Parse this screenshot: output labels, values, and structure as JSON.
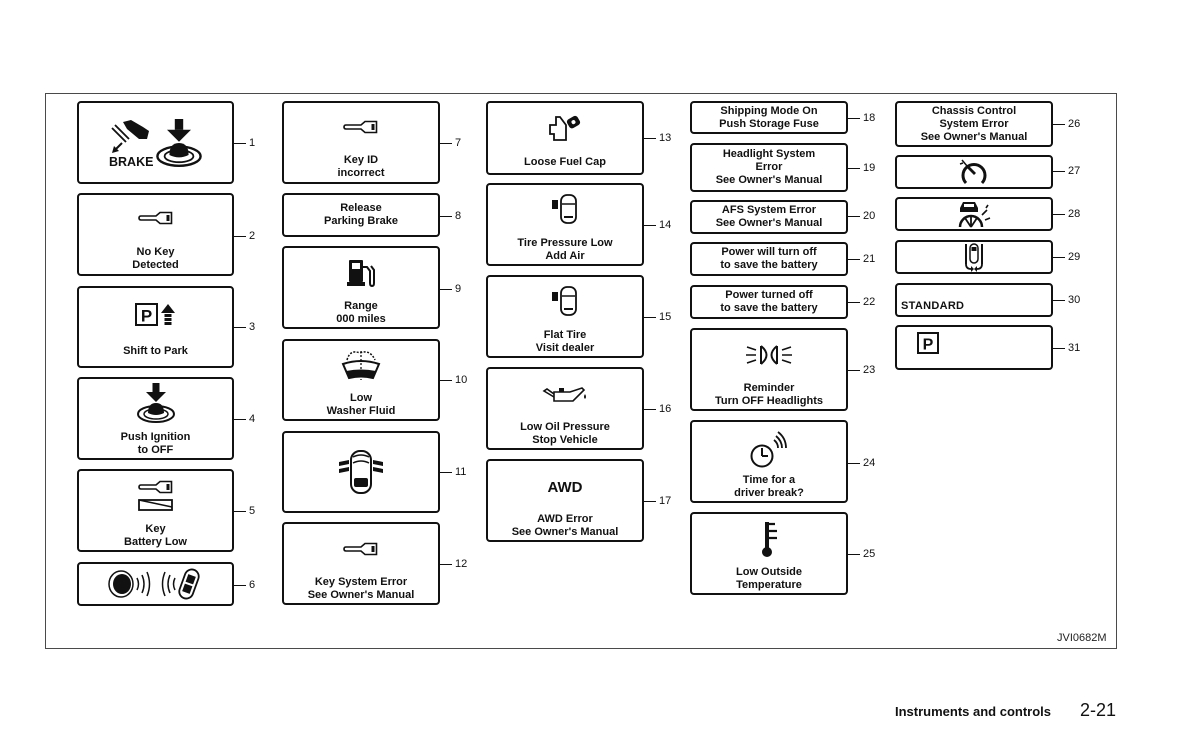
{
  "figure": {
    "code": "JVI0682M",
    "items": [
      {
        "number": "1",
        "icon": "brake-push-ignition-icon",
        "icon_text": "BRAKE",
        "lines": []
      },
      {
        "number": "2",
        "icon": "key-icon",
        "lines": [
          "No Key",
          "Detected"
        ]
      },
      {
        "number": "3",
        "icon": "shift-to-park-icon",
        "icon_text": "P",
        "lines": [
          "Shift to Park"
        ]
      },
      {
        "number": "4",
        "icon": "push-ignition-icon",
        "lines": [
          "Push Ignition",
          "to OFF"
        ]
      },
      {
        "number": "5",
        "icon": "key-battery-icon",
        "lines": [
          "Key",
          "Battery Low"
        ]
      },
      {
        "number": "6",
        "icon": "key-fob-signal-icon",
        "lines": []
      },
      {
        "number": "7",
        "icon": "key-icon",
        "lines": [
          "Key ID",
          "incorrect"
        ]
      },
      {
        "number": "8",
        "lines": [
          "Release",
          "Parking Brake"
        ]
      },
      {
        "number": "9",
        "icon": "fuel-pump-icon",
        "lines": [
          "Range",
          "000 miles"
        ]
      },
      {
        "number": "10",
        "icon": "washer-fluid-icon",
        "lines": [
          "Low",
          "Washer Fluid"
        ]
      },
      {
        "number": "11",
        "icon": "door-open-icon",
        "lines": []
      },
      {
        "number": "12",
        "icon": "key-icon",
        "lines": [
          "Key System Error",
          "See Owner's Manual"
        ]
      },
      {
        "number": "13",
        "icon": "fuel-cap-icon",
        "lines": [
          "Loose Fuel Cap"
        ]
      },
      {
        "number": "14",
        "icon": "tire-pressure-icon",
        "lines": [
          "Tire Pressure Low",
          "Add Air"
        ]
      },
      {
        "number": "15",
        "icon": "flat-tire-icon",
        "lines": [
          "Flat Tire",
          "Visit dealer"
        ]
      },
      {
        "number": "16",
        "icon": "oil-can-icon",
        "lines": [
          "Low Oil Pressure",
          "Stop Vehicle"
        ]
      },
      {
        "number": "17",
        "icon_text": "AWD",
        "lines": [
          "AWD Error",
          "See Owner's Manual"
        ]
      },
      {
        "number": "18",
        "lines": [
          "Shipping Mode On",
          "Push Storage Fuse"
        ]
      },
      {
        "number": "19",
        "lines": [
          "Headlight System",
          "Error",
          "See Owner's Manual"
        ]
      },
      {
        "number": "20",
        "lines": [
          "AFS System Error",
          "See Owner's Manual"
        ]
      },
      {
        "number": "21",
        "lines": [
          "Power will turn off",
          "to save the battery"
        ]
      },
      {
        "number": "22",
        "lines": [
          "Power turned off",
          "to save the battery"
        ]
      },
      {
        "number": "23",
        "icon": "headlight-icon",
        "lines": [
          "Reminder",
          "Turn OFF Headlights"
        ]
      },
      {
        "number": "24",
        "icon": "clock-break-icon",
        "lines": [
          "Time for a",
          "driver break?"
        ]
      },
      {
        "number": "25",
        "icon": "thermometer-icon",
        "lines": [
          "Low Outside",
          "Temperature"
        ]
      },
      {
        "number": "26",
        "lines": [
          "Chassis Control",
          "System Error",
          "See Owner's Manual"
        ]
      },
      {
        "number": "27",
        "icon": "speedometer-hand-icon",
        "lines": []
      },
      {
        "number": "28",
        "icon": "driver-assist-gauge-icon",
        "lines": []
      },
      {
        "number": "29",
        "icon": "car-sonar-icon",
        "lines": []
      },
      {
        "number": "30",
        "lines": [
          "STANDARD"
        ]
      },
      {
        "number": "31",
        "icon": "park-indicator-icon",
        "icon_text": "P",
        "lines": []
      }
    ]
  },
  "footer": {
    "section": "Instruments and controls",
    "page": "2-21"
  }
}
